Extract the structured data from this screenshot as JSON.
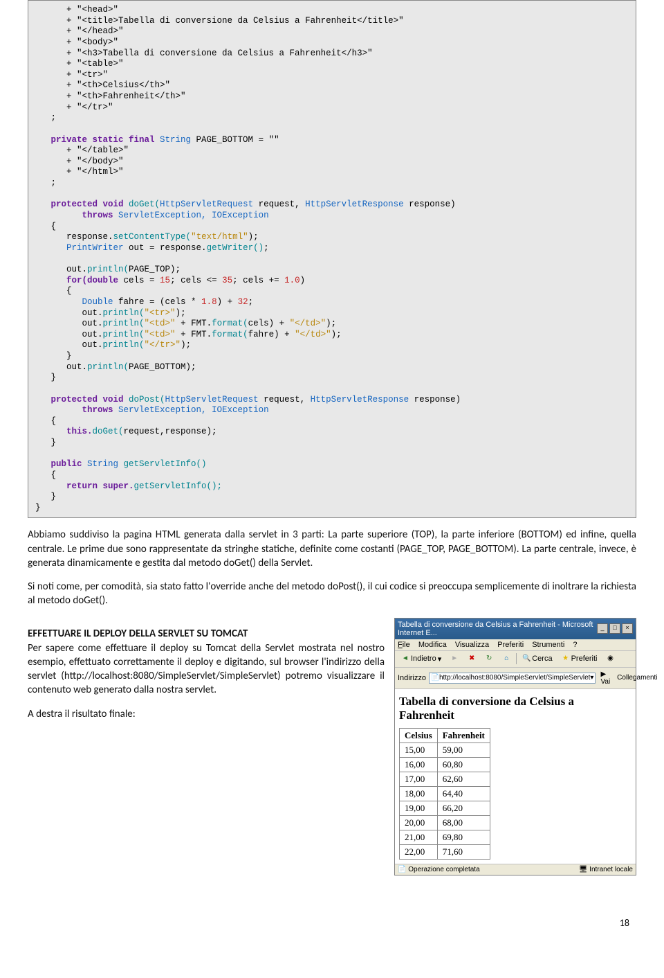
{
  "code": {
    "l1": "      + \"<head>\"",
    "l2": "      + \"<title>Tabella di conversione da Celsius a Fahrenheit</title>\"",
    "l3": "      + \"</head>\"",
    "l4": "      + \"<body>\"",
    "l5": "      + \"<h3>Tabella di conversione da Celsius a Fahrenheit</h3>\"",
    "l6": "      + \"<table>\"",
    "l7": "      + \"<tr>\"",
    "l8": "      + \"<th>Celsius</th>\"",
    "l9": "      + \"<th>Fahrenheit</th>\"",
    "l10": "      + \"</tr>\"",
    "l11": "   ;",
    "l12": "",
    "l13a": "   private static final ",
    "l13b": "String",
    "l13c": " PAGE_BOTTOM = \"\"",
    "l14": "      + \"</table>\"",
    "l15": "      + \"</body>\"",
    "l16": "      + \"</html>\"",
    "l17": "   ;",
    "l18": "",
    "l19a": "   protected void ",
    "l19b": "doGet(",
    "l19c": "HttpServletRequest",
    "l19d": " request, ",
    "l19e": "HttpServletResponse",
    "l19f": " response)",
    "l20a": "         throws ",
    "l20b": "ServletException, IOException",
    "l21": "   {",
    "l22a": "      response.",
    "l22b": "setContentType(",
    "l22c": "\"text/html\"",
    "l22d": ");",
    "l23a": "      PrintWriter",
    "l23b": " out = response.",
    "l23c": "getWriter()",
    ";": ";",
    "l24": "",
    "l25a": "      out.",
    "l25b": "println(",
    "l25c": "PAGE_TOP",
    "l25d": ");",
    "l26a": "      for(double ",
    "l26b": "cels = ",
    "l26c": "15",
    "l26d": "; cels <= ",
    "l26e": "35",
    "l26f": "; cels += ",
    "l26g": "1.0",
    "l26h": ")",
    "l27": "      {",
    "l28a": "         Double",
    "l28b": " fahre = (cels * ",
    "l28c": "1.8",
    "l28d": ") + ",
    "l28e": "32",
    "l28f": ";",
    "l29a": "         out.",
    "l29b": "println(",
    "l29c": "\"<tr>\"",
    "l29d": ");",
    "l30a": "         out.",
    "l30b": "println(",
    "l30c": "\"<td>\"",
    "l30d": " + FMT.",
    "l30e": "format(",
    "l30f": "cels) + ",
    "l30g": "\"</td>\"",
    "l30h": ");",
    "l31a": "         out.",
    "l31b": "println(",
    "l31c": "\"<td>\"",
    "l31d": " + FMT.",
    "l31e": "format(",
    "l31f": "fahre) + ",
    "l31g": "\"</td>\"",
    "l31h": ");",
    "l32a": "         out.",
    "l32b": "println(",
    "l32c": "\"</tr>\"",
    "l32d": ");",
    "l33": "      }",
    "l34a": "      out.",
    "l34b": "println(",
    "l34c": "PAGE_BOTTOM",
    "l34d": ");",
    "l35": "   }",
    "l36": "",
    "l37a": "   protected void ",
    "l37b": "doPost(",
    "l37c": "HttpServletRequest",
    "l37d": " request, ",
    "l37e": "HttpServletResponse",
    "l37f": " response)",
    "l38a": "         throws ",
    "l38b": "ServletException, IOException",
    "l39": "   {",
    "l40a": "      this.",
    "l40b": "doGet(",
    "l40c": "request,response);",
    "l41": "   }",
    "l42": "",
    "l43a": "   public ",
    "l43b": "String ",
    "l43c": "getServletInfo()",
    "l44": "   {",
    "l45a": "      return super.",
    "l45b": "getServletInfo();",
    "l46": "   }",
    "l47": "}"
  },
  "para1": "Abbiamo suddiviso la pagina HTML generata dalla servlet in 3 parti: La parte superiore (TOP), la parte inferiore (BOTTOM) ed infine, quella centrale. Le prime due sono rappresentate da stringhe statiche, definite come costanti (PAGE_TOP, PAGE_BOTTOM). La parte centrale, invece, è generata dinamicamente e gestita dal metodo doGet() della Servlet.",
  "para2": "Si noti come, per comodità, sia stato fatto l'override anche del metodo doPost(), il cui codice si preoccupa semplicemente di inoltrare la richiesta al metodo doGet().",
  "section_title": "EFFETTUARE IL DEPLOY DELLA SERVLET SU TOMCAT",
  "para3": "Per sapere come effettuare il deploy su Tomcat della Servlet mostrata nel nostro esempio, effettuato correttamente il deploy e digitando, sul browser l'indirizzo della servlet (http://localhost:8080/SimpleServlet/SimpleServlet) potremo visualizzare il contenuto web generato dalla nostra servlet.",
  "para4": "A destra il risultato finale:",
  "browser": {
    "title": "Tabella di conversione da Celsius a Fahrenheit - Microsoft Internet E...",
    "menu": {
      "file": "File",
      "edit": "Modifica",
      "view": "Visualizza",
      "fav": "Preferiti",
      "tools": "Strumenti",
      "help": "?"
    },
    "tb": {
      "back": "Indietro",
      "search": "Cerca",
      "fav": "Preferiti"
    },
    "addr_label": "Indirizzo",
    "addr": "http://localhost:8080/SimpleServlet/SimpleServlet",
    "go": "Vai",
    "links": "Collegamenti",
    "heading": "Tabella di conversione da Celsius a Fahrenheit",
    "th1": "Celsius",
    "th2": "Fahrenheit",
    "status_left": "Operazione completata",
    "status_right": "Intranet locale"
  },
  "chart_data": {
    "type": "table",
    "title": "Tabella di conversione da Celsius a Fahrenheit",
    "columns": [
      "Celsius",
      "Fahrenheit"
    ],
    "rows": [
      [
        "15,00",
        "59,00"
      ],
      [
        "16,00",
        "60,80"
      ],
      [
        "17,00",
        "62,60"
      ],
      [
        "18,00",
        "64,40"
      ],
      [
        "19,00",
        "66,20"
      ],
      [
        "20,00",
        "68,00"
      ],
      [
        "21,00",
        "69,80"
      ],
      [
        "22,00",
        "71,60"
      ]
    ]
  },
  "page_number": "18"
}
